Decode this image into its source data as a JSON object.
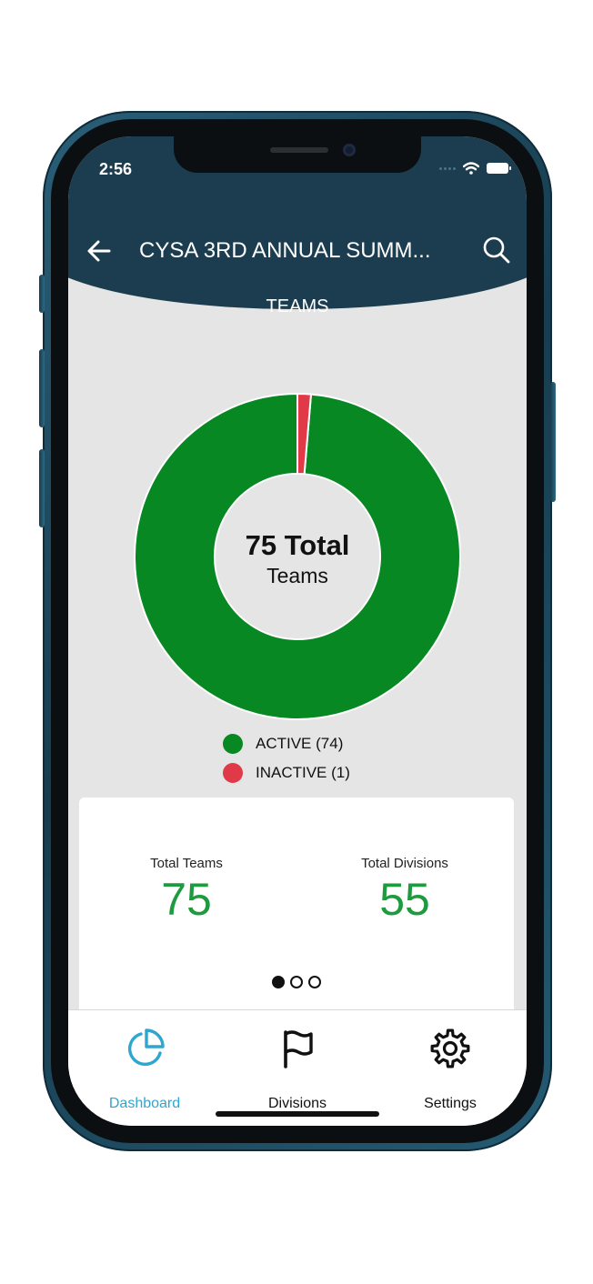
{
  "status_bar": {
    "time": "2:56"
  },
  "header": {
    "title": "CYSA 3RD ANNUAL SUMM...",
    "section": "TEAMS"
  },
  "icons": {
    "back": "arrow-left-icon",
    "search": "search-icon",
    "dashboard": "pie-chart-icon",
    "divisions": "flag-icon",
    "settings": "gear-icon"
  },
  "chart_data": {
    "type": "pie",
    "title": "75 Total",
    "subtitle": "Teams",
    "categories": [
      "ACTIVE (74)",
      "INACTIVE (1)"
    ],
    "values": [
      74,
      1
    ],
    "colors": [
      "#078822",
      "#e03a48"
    ],
    "legend_position": "bottom"
  },
  "stats": {
    "total_teams_label": "Total Teams",
    "total_teams_value": "75",
    "total_divisions_label": "Total Divisions",
    "total_divisions_value": "55"
  },
  "pager": {
    "pages": 3,
    "current": 1
  },
  "tabs": [
    {
      "label": "Dashboard",
      "active": true
    },
    {
      "label": "Divisions",
      "active": false
    },
    {
      "label": "Settings",
      "active": false
    }
  ],
  "colors": {
    "header": "#1b3d4f",
    "accent": "#2fa6d0",
    "stat_value": "#1e9b3f",
    "background": "#e5e5e5"
  }
}
